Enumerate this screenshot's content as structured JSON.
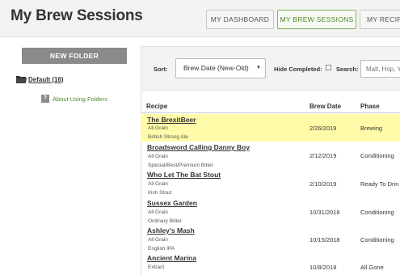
{
  "header": {
    "title": "My Brew Sessions",
    "nav": {
      "dashboard": "MY DASHBOARD",
      "sessions": "MY BREW SESSIONS",
      "recipes": "MY RECIPE"
    }
  },
  "sidebar": {
    "new_folder": "NEW FOLDER",
    "folder_label": "Default (16)",
    "about": "About Using Folders",
    "help_glyph": "?"
  },
  "filters": {
    "sort_label": "Sort:",
    "sort_value": "Brew Date (New-Old)",
    "hide_completed_label": "Hide Completed:",
    "hide_completed_checked": false,
    "search_label": "Search:",
    "search_placeholder": "Malt, Hop, Y"
  },
  "table": {
    "columns": [
      "Recipe",
      "Brew Date",
      "Phase"
    ],
    "rows": [
      {
        "name": "The BrexitBeer",
        "type": "All Grain",
        "style": "British Strong Ale",
        "date": "2/26/2019",
        "phase": "Brewing",
        "highlighted": true
      },
      {
        "name": "Broadsword Calling Danny Boy",
        "type": "All Grain",
        "style": "Special/Best/Premium Bitter",
        "date": "2/12/2019",
        "phase": "Conditioning",
        "highlighted": false
      },
      {
        "name": "Who Let The Bat Stout",
        "type": "All Grain",
        "style": "Irish Stout",
        "date": "2/10/2019",
        "phase": "Ready To Drin",
        "highlighted": false
      },
      {
        "name": "Sussex Garden",
        "type": "All Grain",
        "style": "Ordinary Bitter",
        "date": "10/31/2018",
        "phase": "Conditioning",
        "highlighted": false
      },
      {
        "name": "Ashley's Mash",
        "type": "All Grain",
        "style": "English IPA",
        "date": "10/15/2018",
        "phase": "Conditioning",
        "highlighted": false
      },
      {
        "name": "Ancient Marina",
        "type": "Extract",
        "style": "",
        "date": "10/8/2018",
        "phase": "All Gone",
        "highlighted": false
      }
    ]
  },
  "colors": {
    "accent_green": "#4f8a2c",
    "highlight_row": "#fffba8",
    "button_gray": "#8a8a8a"
  },
  "icons": {
    "folder": "folder-icon",
    "help": "help-icon",
    "caret": "chevron-down-icon"
  }
}
